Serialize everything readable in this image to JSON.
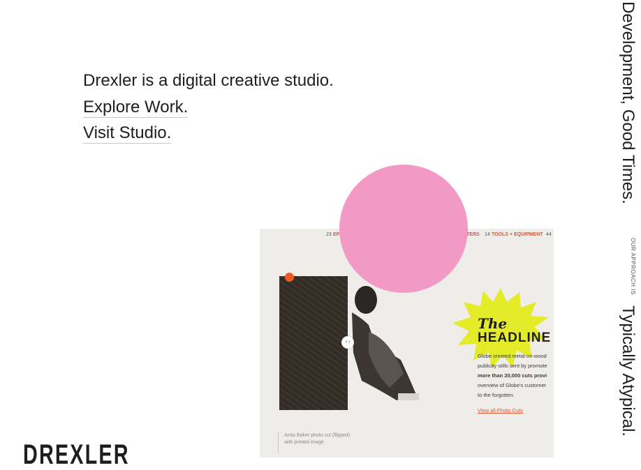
{
  "hero": {
    "tagline": "Drexler is a digital creative studio.",
    "explore_link": "Explore Work.",
    "visit_link": "Visit Studio."
  },
  "logo": {
    "text": "DREXLER"
  },
  "side_text": {
    "line1": "Development, Good Times.",
    "small": "OUR APPROACH IS",
    "line2": "Typically Atypical."
  },
  "card": {
    "nav": {
      "num1": "23",
      "item1": "EP",
      "item2": "TERS",
      "num2": "14",
      "item3": "TOOLS + EQUIPMENT",
      "num3": "44"
    },
    "headline_the": "The",
    "headline": "HEADLINE",
    "body_lines": [
      "Globe created metal-on-wood",
      "publicity stills sent by promote",
      "more than 20,000 cuts provi",
      "overview of Globe's customer",
      "to the forgotten."
    ],
    "view_link": "View all Photo Cuts",
    "caption_line1": "Anita Baker photo cut (flipped)",
    "caption_line2": "with printed image",
    "slider_glyph": "‹ ›"
  },
  "colors": {
    "pink": "#f29ac5",
    "orange": "#f15a24",
    "yellow": "#e4ec2a",
    "card_bg": "#efedea"
  }
}
